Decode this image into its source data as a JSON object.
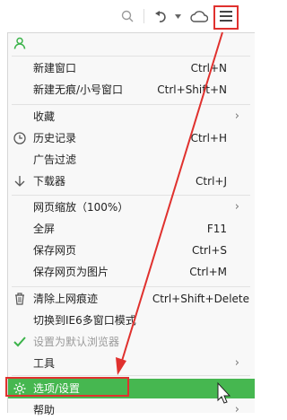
{
  "toolbar": {
    "icons": [
      "search-icon",
      "undo-icon",
      "cloud-icon",
      "menu-icon"
    ]
  },
  "menu": {
    "account_icon": "user-icon",
    "items": [
      {
        "label": "新建窗口",
        "shortcut": "Ctrl+N"
      },
      {
        "label": "新建无痕/小号窗口",
        "shortcut": "Ctrl+Shift+N"
      },
      {
        "label": "收藏",
        "shortcut": ""
      },
      {
        "label": "历史记录",
        "shortcut": "Ctrl+H"
      },
      {
        "label": "广告过滤",
        "shortcut": ""
      },
      {
        "label": "下载器",
        "shortcut": "Ctrl+J"
      },
      {
        "label": "网页缩放（100%）",
        "shortcut": ""
      },
      {
        "label": "全屏",
        "shortcut": "F11"
      },
      {
        "label": "保存网页",
        "shortcut": "Ctrl+S"
      },
      {
        "label": "保存网页为图片",
        "shortcut": "Ctrl+M"
      },
      {
        "label": "清除上网痕迹",
        "shortcut": "Ctrl+Shift+Delete"
      },
      {
        "label": "切换到IE6多窗口模式",
        "shortcut": ""
      },
      {
        "label": "设置为默认浏览器",
        "shortcut": ""
      },
      {
        "label": "工具",
        "shortcut": ""
      },
      {
        "label": "选项/设置",
        "shortcut": ""
      },
      {
        "label": "帮助",
        "shortcut": ""
      }
    ]
  },
  "colors": {
    "highlight": "#46b750",
    "annotation_red": "#e0312e",
    "brand_green": "#3bb34a"
  }
}
